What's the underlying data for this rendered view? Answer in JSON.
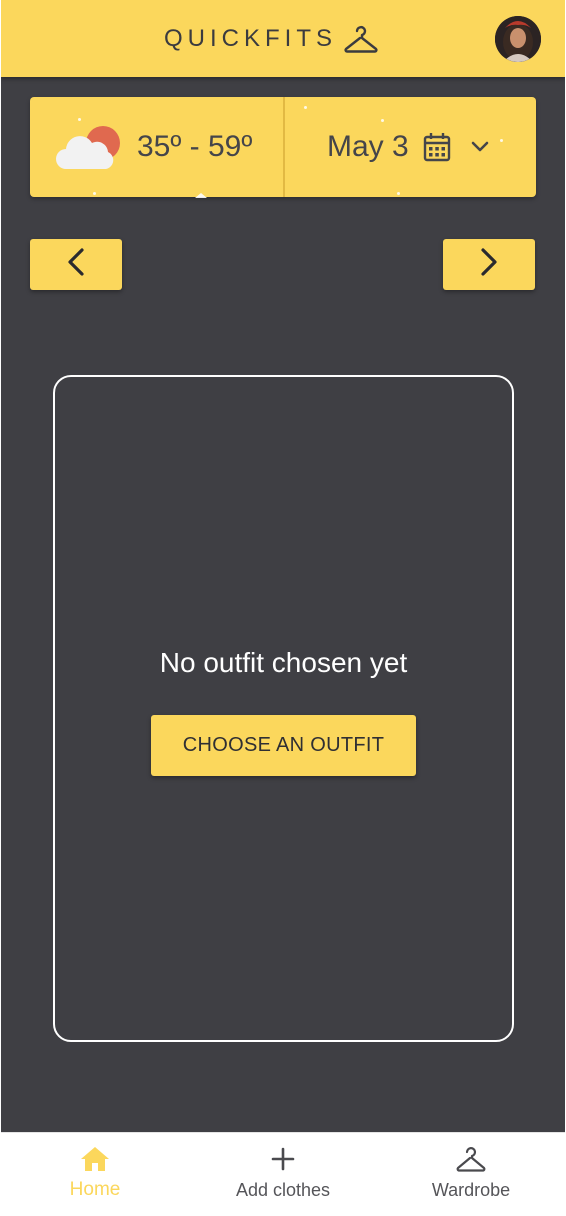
{
  "header": {
    "app_name": "QUICKFITS",
    "logo_icon": "hanger-icon",
    "profile_avatar": "user-avatar"
  },
  "forecast": {
    "weather_icon": "partly-cloudy-icon",
    "temperature_range": "35º - 59º",
    "date": "May 3",
    "calendar_icon": "calendar-icon",
    "dropdown_icon": "chevron-down-icon"
  },
  "navigation": {
    "prev_icon": "chevron-left-icon",
    "next_icon": "chevron-right-icon"
  },
  "outfit": {
    "empty_message": "No outfit chosen yet",
    "choose_button": "CHOOSE AN OUTFIT"
  },
  "bottom_nav": {
    "tabs": [
      {
        "label": "Home",
        "icon": "home-icon",
        "active": true
      },
      {
        "label": "Add clothes",
        "icon": "plus-icon",
        "active": false
      },
      {
        "label": "Wardrobe",
        "icon": "hanger-icon",
        "active": false
      }
    ]
  },
  "colors": {
    "accent": "#fbd75c",
    "background": "#3f3f44",
    "text_dark": "#45454a",
    "sun": "#e0694f"
  }
}
